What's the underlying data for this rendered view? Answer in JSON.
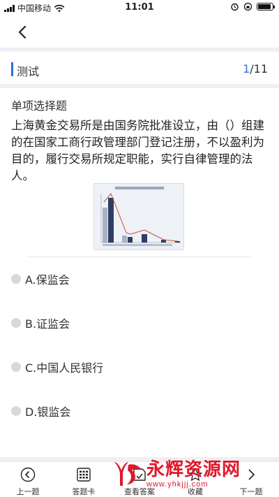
{
  "status_bar": {
    "carrier": "中国移动",
    "time": "11:01",
    "battery_level": 0.9
  },
  "nav": {
    "back_icon": "chevron-left-icon"
  },
  "section": {
    "title": "测试",
    "current": "1",
    "total": "/11"
  },
  "question": {
    "type": "单项选择题",
    "text": "上海黄金交易所是由国务院批准设立，由（）组建的在国家工商行政管理部门登记注册，不以盈利为目的，履行交易所规定职能，实行自律管理的法人。"
  },
  "options": [
    {
      "label": "A.保监会"
    },
    {
      "label": "B.证监会"
    },
    {
      "label": "C.中国人民银行"
    },
    {
      "label": "D.银监会"
    }
  ],
  "footer": {
    "tabs": [
      {
        "label": "上一题",
        "icon": "prev-circle-icon"
      },
      {
        "label": "答题卡",
        "icon": "answer-card-icon"
      },
      {
        "label": "查看答案",
        "icon": "view-answer-icon"
      },
      {
        "label": "收藏",
        "icon": "favorite-icon"
      },
      {
        "label": "下一题",
        "icon": "next-icon"
      }
    ]
  },
  "watermark": {
    "brand": "永辉资源网",
    "url": "www.yhkjjj.com"
  },
  "colors": {
    "accent": "#2f6fd6",
    "watermark": "#e0182a",
    "radio": "#d9d9dc"
  }
}
